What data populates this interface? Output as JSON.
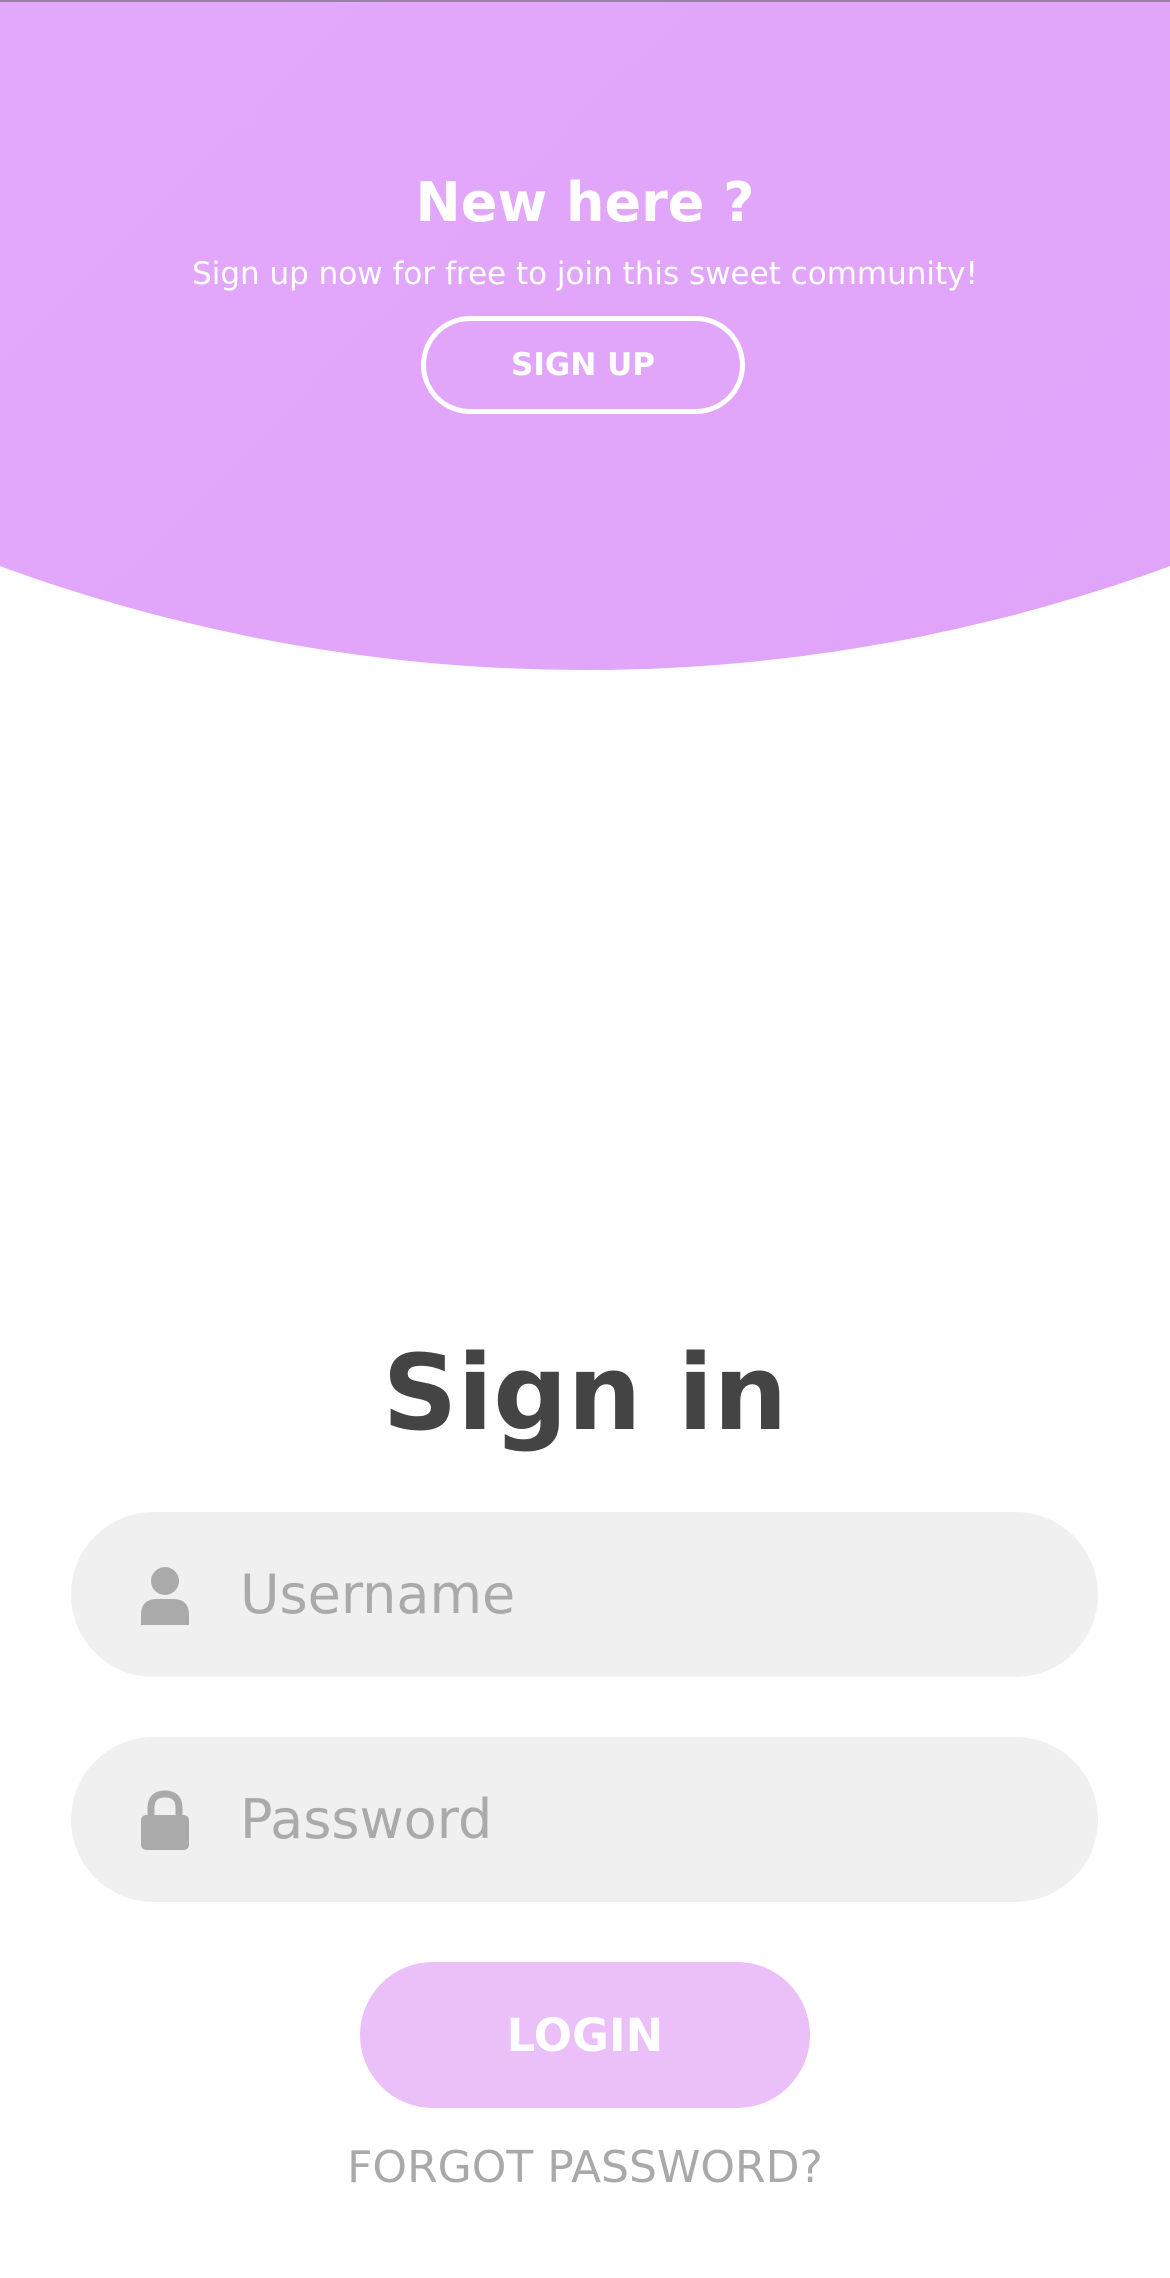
{
  "colors": {
    "panel_gradient_start": "#e6b0fb",
    "panel_gradient_end": "#dfa2f9",
    "login_button": "#ebbff8",
    "field_background": "#f0f0f0",
    "title_text": "#444444",
    "placeholder_text": "#aaaaaa"
  },
  "signup_panel": {
    "title": "New here ?",
    "subtitle": "Sign up now for free to join this sweet community!",
    "signup_button": "SIGN UP"
  },
  "signin_form": {
    "title": "Sign in",
    "username": {
      "icon": "user-icon",
      "placeholder": "Username"
    },
    "password": {
      "icon": "lock-icon",
      "placeholder": "Password"
    },
    "login_button": "LOGIN",
    "forgot_link": "FORGOT PASSWORD?"
  }
}
